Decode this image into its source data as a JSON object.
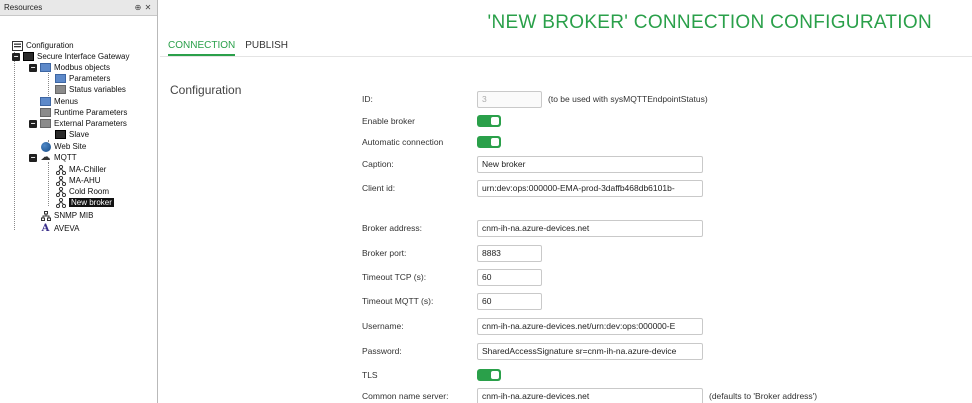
{
  "resources": {
    "title": "Resources",
    "pin_glyph": "⊕",
    "close_glyph": "✕",
    "tree": [
      {
        "label": "Configuration",
        "icon": "configuration-icon"
      },
      {
        "label": "Secure Interface Gateway",
        "icon": "gateway-icon"
      },
      {
        "label": "Modbus objects",
        "icon": "modbus-icon"
      },
      {
        "label": "Parameters",
        "icon": "parameters-icon"
      },
      {
        "label": "Status variables",
        "icon": "status-variables-icon"
      },
      {
        "label": "Menus",
        "icon": "menus-icon"
      },
      {
        "label": "Runtime Parameters",
        "icon": "runtime-icon"
      },
      {
        "label": "External Parameters",
        "icon": "external-icon"
      },
      {
        "label": "Slave",
        "icon": "slave-icon"
      },
      {
        "label": "Web Site",
        "icon": "globe-icon"
      },
      {
        "label": "MQTT",
        "icon": "cloud-icon"
      },
      {
        "label": "MA-Chiller",
        "icon": "broker-icon"
      },
      {
        "label": "MA-AHU",
        "icon": "broker-icon"
      },
      {
        "label": "Cold Room",
        "icon": "broker-icon"
      },
      {
        "label": "New broker",
        "icon": "broker-icon"
      },
      {
        "label": "SNMP MIB",
        "icon": "network-icon"
      },
      {
        "label": "AVEVA",
        "icon": "aveva-icon"
      }
    ]
  },
  "main": {
    "title": "'NEW BROKER' CONNECTION CONFIGURATION",
    "tabs": [
      {
        "label": "CONNECTION",
        "active": true
      },
      {
        "label": "PUBLISH",
        "active": false
      }
    ],
    "section_title": "Configuration",
    "fields": {
      "id": {
        "label": "ID:",
        "value": "3",
        "hint": "(to be used with sysMQTTEndpointStatus)"
      },
      "enable_broker": {
        "label": "Enable broker",
        "on": true
      },
      "automatic_connection": {
        "label": "Automatic connection",
        "on": true
      },
      "caption": {
        "label": "Caption:",
        "value": "New broker"
      },
      "client_id": {
        "label": "Client id:",
        "value": "urn:dev:ops:000000-EMA-prod-3daffb468db6101b-"
      },
      "broker_address": {
        "label": "Broker address:",
        "value": "cnm-ih-na.azure-devices.net"
      },
      "broker_port": {
        "label": "Broker port:",
        "value": "8883"
      },
      "timeout_tcp": {
        "label": "Timeout TCP (s):",
        "value": "60"
      },
      "timeout_mqtt": {
        "label": "Timeout MQTT (s):",
        "value": "60"
      },
      "username": {
        "label": "Username:",
        "value": "cnm-ih-na.azure-devices.net/urn:dev:ops:000000-E"
      },
      "password": {
        "label": "Password:",
        "value": "SharedAccessSignature sr=cnm-ih-na.azure-device"
      },
      "tls": {
        "label": "TLS",
        "on": true
      },
      "common_name_server": {
        "label": "Common name server:",
        "value": "cnm-ih-na.azure-devices.net",
        "hint": "(defaults to 'Broker address')"
      }
    }
  },
  "colors": {
    "accent": "#2aa04a",
    "selection": "#111111"
  }
}
